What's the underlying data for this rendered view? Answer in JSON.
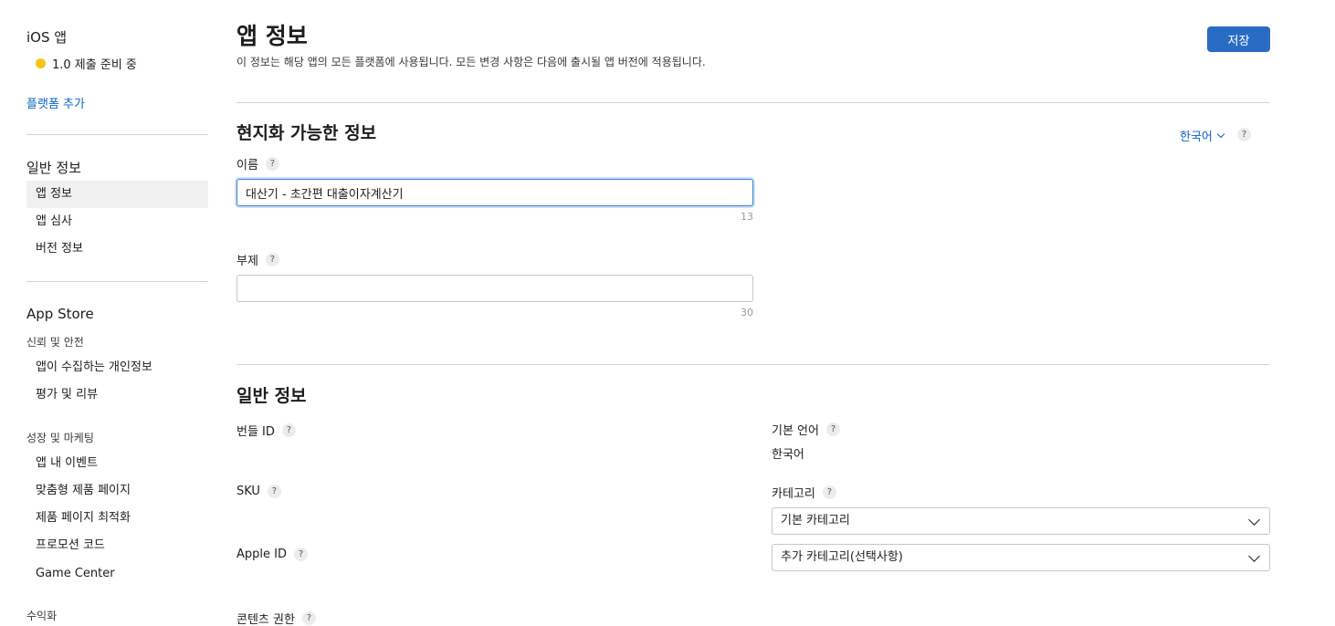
{
  "sidebar": {
    "app_title": "iOS 앱",
    "status": "1.0 제출 준비 중",
    "add_platform": "플랫폼 추가",
    "general_section": {
      "title": "일반 정보",
      "items": [
        "앱 정보",
        "앱 심사",
        "버전 정보"
      ]
    },
    "app_store_section": {
      "title": "App Store",
      "trust_heading": "신뢰 및 안전",
      "trust_items": [
        "앱이 수집하는 개인정보",
        "평가 및 리뷰"
      ],
      "growth_heading": "성장 및 마케팅",
      "growth_items": [
        "앱 내 이벤트",
        "맞춤형 제품 페이지",
        "제품 페이지 최적화",
        "프로모션 코드",
        "Game Center"
      ],
      "monetization_heading": "수익화"
    }
  },
  "header": {
    "title": "앱 정보",
    "description": "이 정보는 해당 앱의 모든 플랫폼에 사용됩니다. 모든 변경 사항은 다음에 출시될 앱 버전에 적용됩니다.",
    "save_label": "저장"
  },
  "localizable": {
    "title": "현지화 가능한 정보",
    "language": "한국어",
    "name_label": "이름",
    "name_value": "대산기 - 초간편 대출이자계산기",
    "name_counter": "13",
    "subtitle_label": "부제",
    "subtitle_value": "",
    "subtitle_counter": "30"
  },
  "general": {
    "title": "일반 정보",
    "bundle_id_label": "번들 ID",
    "sku_label": "SKU",
    "apple_id_label": "Apple ID",
    "content_rights_label": "콘텐츠 권한",
    "primary_language_label": "기본 언어",
    "primary_language_value": "한국어",
    "category_label": "카테고리",
    "primary_category": "기본 카테고리",
    "secondary_category": "추가 카테고리(선택사항)"
  },
  "help_glyph": "?",
  "colors": {
    "accent": "#2a6cc4",
    "link": "#0b63c5",
    "status_dot": "#f5c518"
  }
}
